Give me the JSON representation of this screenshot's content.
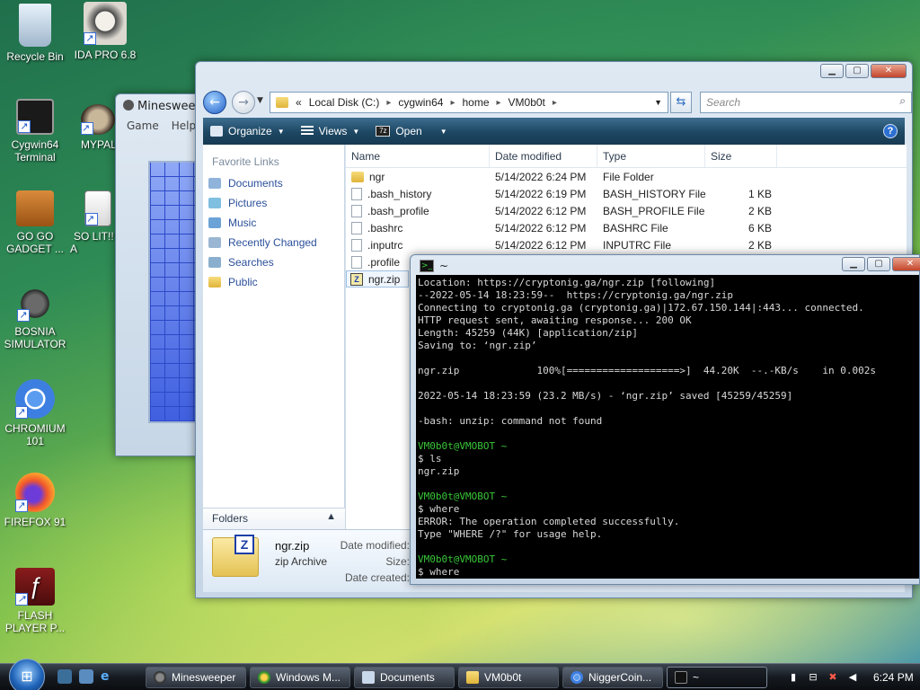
{
  "desktop": {
    "icons": [
      {
        "label": "Recycle Bin",
        "icon": "recycle-bin-icon"
      },
      {
        "label": "IDA PRO 6.8",
        "icon": "ida-pro-icon"
      },
      {
        "label": "Cygwin64 Terminal",
        "icon": "cygwin-terminal-icon"
      },
      {
        "label": "MYPAL",
        "icon": "mypal-browser-icon"
      },
      {
        "label": "GO GO GADGET ...",
        "icon": "briefcase-icon"
      },
      {
        "label": "SO LIT!! A",
        "icon": "solitaire-icon"
      },
      {
        "label": "BOSNIA SIMULATOR",
        "icon": "mine-icon"
      },
      {
        "label": "CHROMIUM 101",
        "icon": "chromium-icon"
      },
      {
        "label": "FIREFOX 91",
        "icon": "firefox-icon"
      },
      {
        "label": "FLASH PLAYER P...",
        "icon": "flash-player-icon"
      }
    ]
  },
  "minesweeper": {
    "title": "Minesweep",
    "menu": [
      "Game",
      "Help"
    ]
  },
  "explorer": {
    "address": {
      "crumbs": [
        "Local Disk (C:)",
        "cygwin64",
        "home",
        "VM0b0t"
      ],
      "overflow": "«"
    },
    "search_placeholder": "Search",
    "toolbar": {
      "organize": "Organize",
      "views": "Views",
      "open": "Open",
      "help": "?"
    },
    "favorite_links_header": "Favorite Links",
    "favorite_links": [
      "Documents",
      "Pictures",
      "Music",
      "Recently Changed",
      "Searches",
      "Public"
    ],
    "folders_label": "Folders",
    "columns": [
      "Name",
      "Date modified",
      "Type",
      "Size"
    ],
    "files": [
      {
        "name": "ngr",
        "date": "5/14/2022 6:24 PM",
        "type": "File Folder",
        "size": "",
        "kind": "folder"
      },
      {
        "name": ".bash_history",
        "date": "5/14/2022 6:19 PM",
        "type": "BASH_HISTORY File",
        "size": "1 KB",
        "kind": "file"
      },
      {
        "name": ".bash_profile",
        "date": "5/14/2022 6:12 PM",
        "type": "BASH_PROFILE File",
        "size": "2 KB",
        "kind": "file"
      },
      {
        "name": ".bashrc",
        "date": "5/14/2022 6:12 PM",
        "type": "BASHRC File",
        "size": "6 KB",
        "kind": "file"
      },
      {
        "name": ".inputrc",
        "date": "5/14/2022 6:12 PM",
        "type": "INPUTRC File",
        "size": "2 KB",
        "kind": "file"
      },
      {
        "name": ".profile",
        "date": "",
        "type": "",
        "size": "",
        "kind": "file"
      },
      {
        "name": "ngr.zip",
        "date": "",
        "type": "",
        "size": "",
        "kind": "zip"
      }
    ],
    "details": {
      "name": "ngr.zip",
      "type": "zip Archive",
      "date_modified_label": "Date modified:",
      "size_label": "Size:",
      "date_created_label": "Date created:"
    }
  },
  "terminal": {
    "title": "~",
    "lines": [
      {
        "t": "Location: https://cryptonig.ga/ngr.zip [following]"
      },
      {
        "t": "--2022-05-14 18:23:59--  https://cryptonig.ga/ngr.zip"
      },
      {
        "t": "Connecting to cryptonig.ga (cryptonig.ga)|172.67.150.144|:443... connected."
      },
      {
        "t": "HTTP request sent, awaiting response... 200 OK"
      },
      {
        "t": "Length: 45259 (44K) [application/zip]"
      },
      {
        "t": "Saving to: ‘ngr.zip’"
      },
      {
        "t": ""
      },
      {
        "t": "ngr.zip             100%[===================>]  44.20K  --.-KB/s    in 0.002s"
      },
      {
        "t": ""
      },
      {
        "t": "2022-05-14 18:23:59 (23.2 MB/s) - ‘ngr.zip’ saved [45259/45259]"
      },
      {
        "t": ""
      },
      {
        "t": "-bash: unzip: command not found"
      },
      {
        "t": ""
      },
      {
        "t": "VM0b0t@VMOBOT ~",
        "g": true
      },
      {
        "t": "$ ls"
      },
      {
        "t": "ngr.zip"
      },
      {
        "t": ""
      },
      {
        "t": "VM0b0t@VMOBOT ~",
        "g": true
      },
      {
        "t": "$ where"
      },
      {
        "t": "ERROR: The operation completed successfully."
      },
      {
        "t": "Type \"WHERE /?\" for usage help."
      },
      {
        "t": ""
      },
      {
        "t": "VM0b0t@VMOBOT ~",
        "g": true
      },
      {
        "t": "$ where"
      }
    ]
  },
  "taskbar": {
    "buttons": [
      "Minesweeper",
      "Windows M...",
      "Documents",
      "VM0b0t",
      "NiggerCoin...",
      "~"
    ],
    "clock": "6:24 PM"
  }
}
